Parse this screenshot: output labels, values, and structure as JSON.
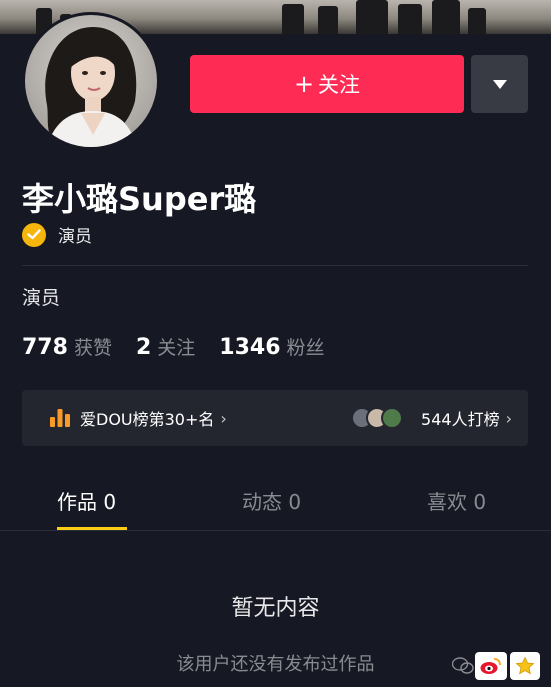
{
  "profile": {
    "name": "李小璐Super璐",
    "verify_label": "演员",
    "bio": "演员",
    "stats": [
      {
        "num": "778",
        "label": "获赞"
      },
      {
        "num": "2",
        "label": "关注"
      },
      {
        "num": "1346",
        "label": "粉丝"
      }
    ]
  },
  "actions": {
    "follow_plus": "+",
    "follow_label": "关注"
  },
  "rank": {
    "left_label": "爱DOU榜第30+名",
    "right_label": "544人打榜",
    "chevron": "›"
  },
  "tabs": [
    {
      "label": "作品 0",
      "active": true
    },
    {
      "label": "动态 0",
      "active": false
    },
    {
      "label": "喜欢 0",
      "active": false
    }
  ],
  "empty": {
    "title": "暂无内容",
    "subtitle": "该用户还没有发布过作品"
  },
  "colors": {
    "background": "#161823",
    "follow_button": "#fe2c55",
    "tab_indicator": "#face15",
    "verified_badge": "#f5b50a",
    "rank_bars": "#f79a26"
  },
  "icons": {
    "verified": "verified-check-icon",
    "rank": "bar-chart-icon",
    "dropdown": "triangle-down-icon"
  }
}
